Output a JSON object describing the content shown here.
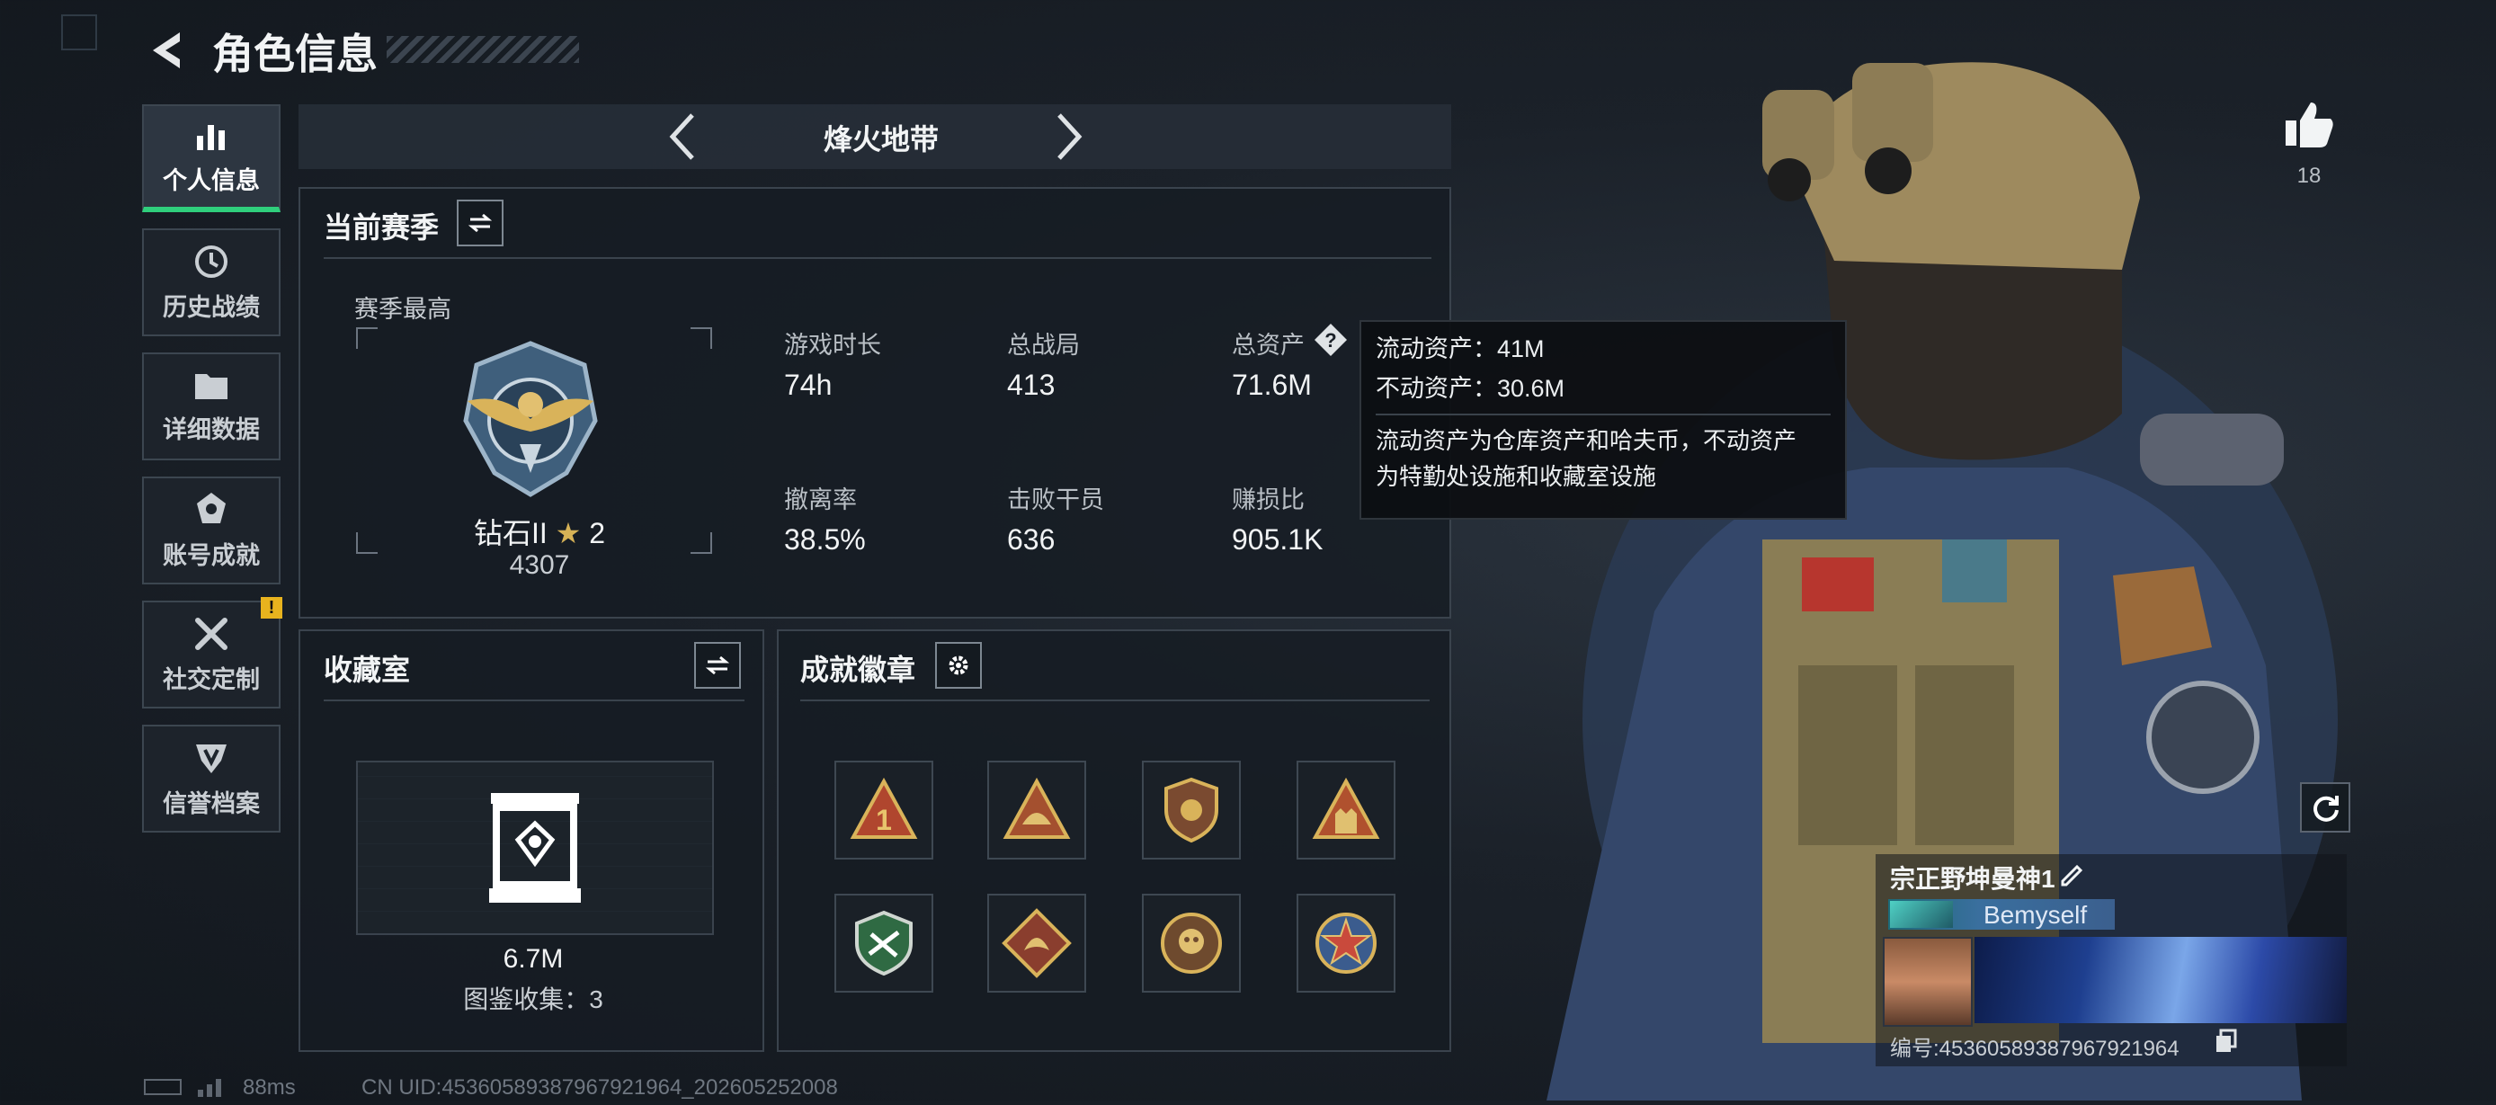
{
  "header": {
    "title": "角色信息",
    "back_icon": "back-arrow-icon"
  },
  "nav": {
    "items": [
      {
        "label": "个人信息",
        "icon": "bar-chart-icon",
        "active": true
      },
      {
        "label": "历史战绩",
        "icon": "history-clock-icon",
        "active": false
      },
      {
        "label": "详细数据",
        "icon": "folder-icon",
        "active": false
      },
      {
        "label": "账号成就",
        "icon": "medal-icon",
        "active": false
      },
      {
        "label": "社交定制",
        "icon": "tools-icon",
        "active": false,
        "alert": "!"
      },
      {
        "label": "信誉档案",
        "icon": "shield-emblem-icon",
        "active": false
      }
    ]
  },
  "mode_selector": {
    "label": "烽火地带"
  },
  "season": {
    "title": "当前赛季",
    "best_label": "赛季最高",
    "rank_name": "钻石II",
    "rank_stars": "2",
    "rank_score": "4307",
    "stats": [
      {
        "label": "游戏时长",
        "value": "74h"
      },
      {
        "label": "总战局",
        "value": "413"
      },
      {
        "label": "总资产",
        "value": "71.6M"
      },
      {
        "label": "撤离率",
        "value": "38.5%"
      },
      {
        "label": "击败干员",
        "value": "636"
      },
      {
        "label": "赚损比",
        "value": "905.1K"
      }
    ]
  },
  "tooltip": {
    "liquid": "流动资产：41M",
    "fixed": "不动资产：30.6M",
    "desc_line1": "流动资产为仓库资产和哈夫币，不动资产",
    "desc_line2": "为特勤处设施和收藏室设施"
  },
  "collection": {
    "title": "收藏室",
    "value": "6.7M",
    "count_text": "图鉴收集：3"
  },
  "achievements": {
    "title": "成就徽章",
    "badges": [
      "triangle-one-badge",
      "helmet-triangle-badge",
      "shield-emblem-badge",
      "soldiers-triangle-badge",
      "green-shield-badge",
      "dragon-diamond-badge",
      "skull-round-badge",
      "star-wreath-badge"
    ]
  },
  "likes": {
    "count": "18",
    "icon": "thumbs-up-icon"
  },
  "player": {
    "name": "宗正野坤曼神1",
    "tag": "Bemyself",
    "id_text": "编号:4536058938796792196​4"
  },
  "footer": {
    "ping": "88ms",
    "uid": "CN UID:4536058938796792​1964_202605252008"
  },
  "colors": {
    "accent": "#2fcf7c",
    "panel_border": "#3a434d",
    "gold": "#d6b256",
    "warning": "#e8b31e"
  }
}
